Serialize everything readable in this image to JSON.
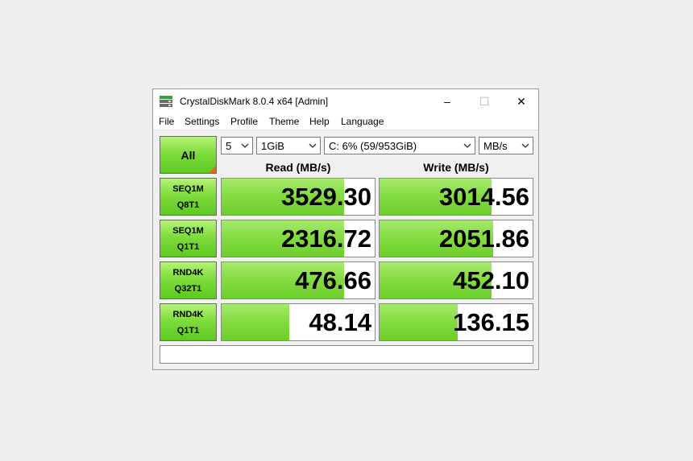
{
  "window": {
    "title": "CrystalDiskMark 8.0.4 x64 [Admin]",
    "controls": {
      "minimize": "–",
      "maximize": "☐",
      "close": "✕"
    }
  },
  "menu": [
    {
      "label": "File"
    },
    {
      "label": "Settings"
    },
    {
      "label": "Profile"
    },
    {
      "label": "Theme"
    },
    {
      "label": "Help"
    },
    {
      "label": "Language"
    }
  ],
  "toolbar": {
    "all_label": "All",
    "count": "5",
    "size": "1GiB",
    "drive": "C: 6% (59/953GiB)",
    "unit": "MB/s"
  },
  "headers": {
    "read": "Read (MB/s)",
    "write": "Write (MB/s)"
  },
  "rows": [
    {
      "line1": "SEQ1M",
      "line2": "Q8T1",
      "read": "3529.30",
      "write": "3014.56",
      "read_fill": 0.8,
      "write_fill": 0.73
    },
    {
      "line1": "SEQ1M",
      "line2": "Q1T1",
      "read": "2316.72",
      "write": "2051.86",
      "read_fill": 0.8,
      "write_fill": 0.74
    },
    {
      "line1": "RND4K",
      "line2": "Q32T1",
      "read": "476.66",
      "write": "452.10",
      "read_fill": 0.8,
      "write_fill": 0.73
    },
    {
      "line1": "RND4K",
      "line2": "Q1T1",
      "read": "48.14",
      "write": "136.15",
      "read_fill": 0.44,
      "write_fill": 0.51
    }
  ],
  "status": "",
  "colors": {
    "accent_green": "#7fdc3c",
    "corner_orange": "#e06b1a"
  }
}
